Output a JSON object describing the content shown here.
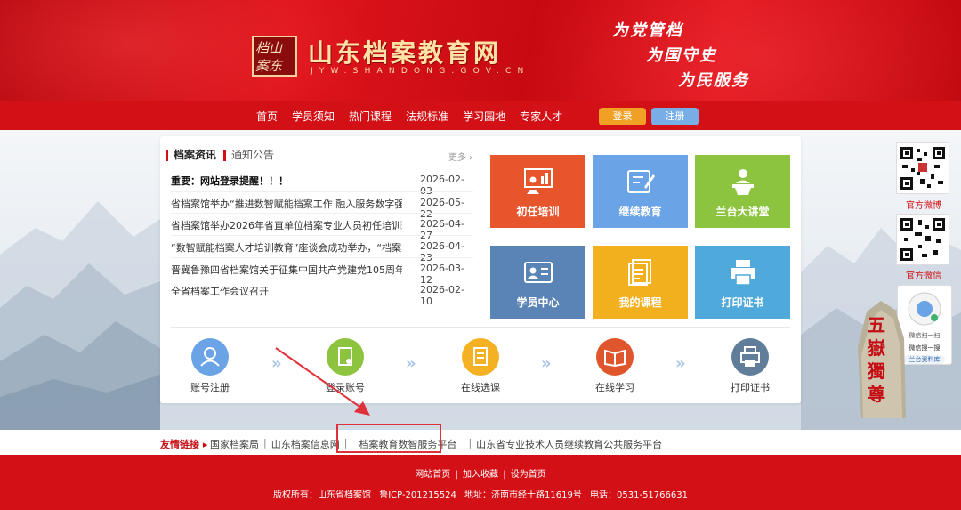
{
  "header": {
    "logo_text": "档山案东",
    "site_title": "山东档案教育网",
    "site_domain": "JYW.SHANDONG.GOV.CN",
    "slogans": [
      "为党管档",
      "为国守史",
      "为民服务"
    ]
  },
  "nav": {
    "items": [
      "首页",
      "学员须知",
      "热门课程",
      "法规标准",
      "学习园地",
      "专家人才"
    ],
    "login": "登录",
    "register": "注册"
  },
  "news": {
    "tabs": [
      "档案资讯",
      "通知公告"
    ],
    "more": "更多 ›",
    "items": [
      {
        "title": "重要：网站登录提醒！！！",
        "date": "2026-02-03",
        "bold": true
      },
      {
        "title": "省档案馆举办“推进数智赋能档案工作 融入服务数字强...",
        "date": "2026-05-22"
      },
      {
        "title": "省档案馆举办2026年省直单位档案专业人员初任培训班",
        "date": "2026-04-27"
      },
      {
        "title": "“数智赋能档案人才培训教育”座谈会成功举办，“档案...",
        "date": "2026-04-23"
      },
      {
        "title": "晋冀鲁豫四省档案馆关于征集中国共产党建党105周年和...",
        "date": "2026-03-12"
      },
      {
        "title": "全省档案工作会议召开",
        "date": "2026-02-10"
      }
    ]
  },
  "tiles": [
    {
      "label": "初任培训",
      "color": "#e7552d"
    },
    {
      "label": "继续教育",
      "color": "#6aa3e6"
    },
    {
      "label": "兰台大讲堂",
      "color": "#8cc43f"
    },
    {
      "label": "学员中心",
      "color": "#5b84b6"
    },
    {
      "label": "我的课程",
      "color": "#f2b01f"
    },
    {
      "label": "打印证书",
      "color": "#4fa9db"
    }
  ],
  "steps": [
    {
      "label": "账号注册",
      "color": "#6aa3e6"
    },
    {
      "label": "登录账号",
      "color": "#8cc43f"
    },
    {
      "label": "在线选课",
      "color": "#f4b123"
    },
    {
      "label": "在线学习",
      "color": "#e0562c"
    },
    {
      "label": "打印证书",
      "color": "#607d99"
    }
  ],
  "side": {
    "qr1_label": "官方微博",
    "qr2_label": "官方微信",
    "card_title": "微信扫一扫",
    "card_search": "微信搜一搜",
    "card_app": "兰台资料库",
    "rock_text": "五嶽獨尊"
  },
  "links": {
    "label": "友情链接",
    "items": [
      "国家档案局",
      "山东档案信息网",
      "档案教育数智服务平台",
      "山东省专业技术人员继续教育公共服务平台"
    ]
  },
  "footer": {
    "links": [
      "网站首页",
      "加入收藏",
      "设为首页"
    ],
    "copyright": "版权所有：山东省档案馆",
    "icp": "鲁ICP-201215524",
    "address": "地址：济南市经十路11619号",
    "phone": "电话：0531-51766631"
  }
}
